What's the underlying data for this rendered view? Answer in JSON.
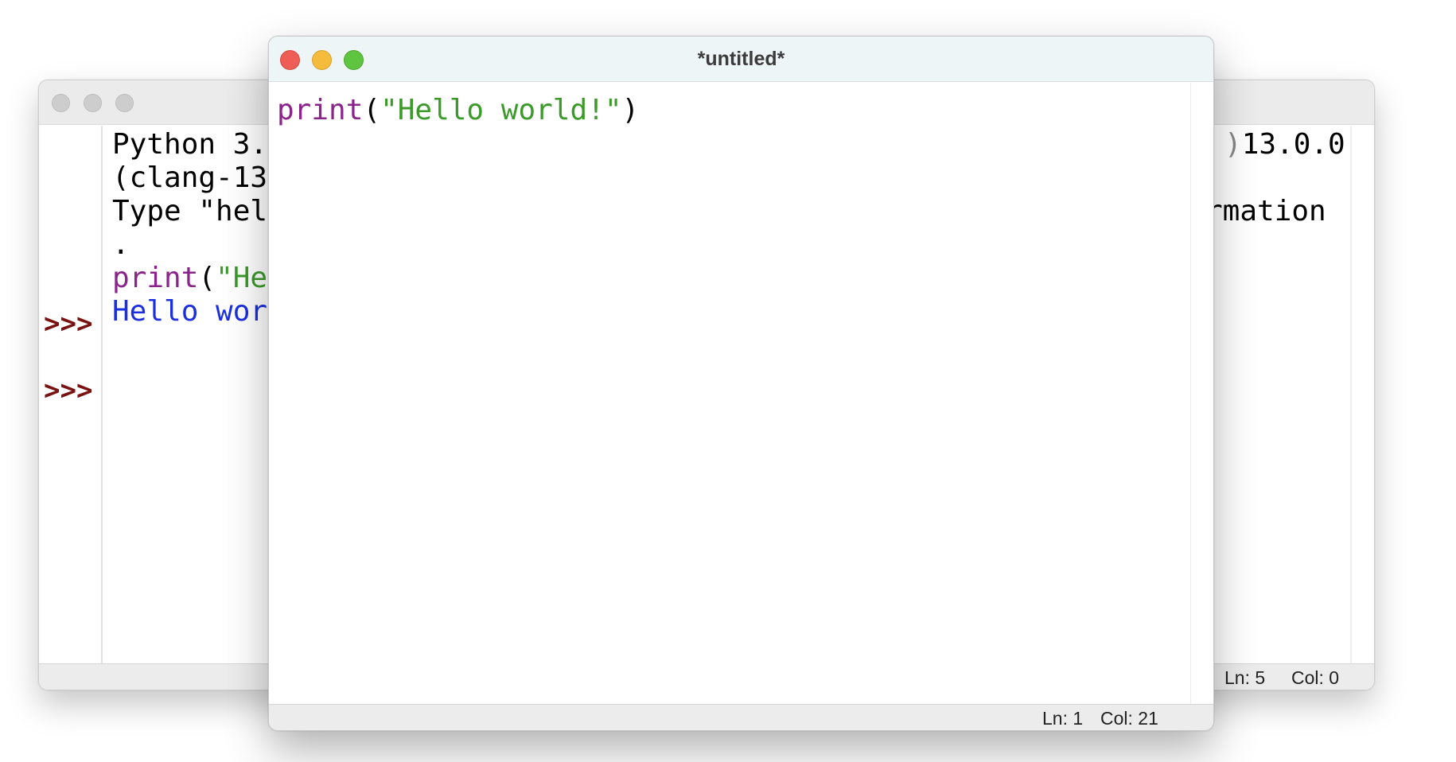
{
  "shell_window": {
    "title": "",
    "traffic_lights_color": "#cdcdcd",
    "lines": [
      {
        "left": "Python 3.",
        "right": "13.0.0"
      },
      {
        "left": "(clang-13",
        "right": ""
      },
      {
        "left": "Type \"hel",
        "right": "rmation"
      },
      {
        "left": ".",
        "right": ""
      }
    ],
    "prompts": [
      ">>>",
      ">>>"
    ],
    "input_line": {
      "builtin": "print",
      "paren_open": "(",
      "string": "\"He"
    },
    "output_line": "Hello wor",
    "right_partial_glyph": ")",
    "status": {
      "ln": "Ln: 5",
      "col": "Col: 0"
    }
  },
  "editor_window": {
    "title": "*untitled*",
    "code": {
      "builtin": "print",
      "paren_open": "(",
      "string": "\"Hello world!\"",
      "paren_close": ")"
    },
    "status": {
      "ln": "Ln: 1",
      "col": "Col: 21"
    },
    "colors": {
      "builtin": "#8a248a",
      "string": "#3c9a2b",
      "output": "#1b2fe0",
      "prompt": "#7a1212",
      "close": "#ee5e56",
      "minimize": "#f4bb3c",
      "maximize": "#5fc43f"
    }
  }
}
